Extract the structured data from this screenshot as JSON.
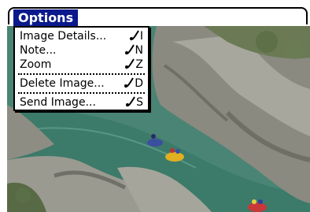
{
  "menubar": {
    "title": "Options"
  },
  "menu": {
    "items": [
      {
        "label": "Image Details...",
        "shortcut": "I"
      },
      {
        "label": "Note...",
        "shortcut": "N"
      },
      {
        "label": "Zoom",
        "shortcut": "Z"
      },
      {
        "label": "Delete Image...",
        "shortcut": "D"
      },
      {
        "label": "Send Image...",
        "shortcut": "S"
      }
    ],
    "shortcut_icon": "graffiti-stroke-icon"
  },
  "photo": {
    "subject": "rafting-river-canyon-photo"
  }
}
